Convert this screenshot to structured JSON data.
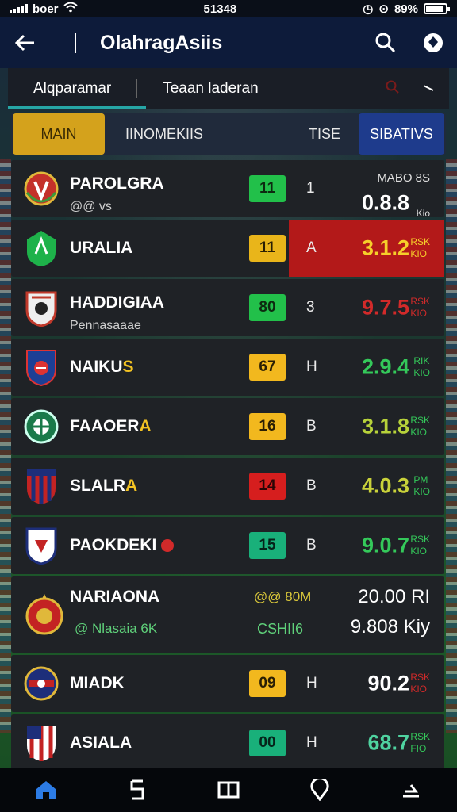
{
  "status": {
    "carrier": "boer",
    "time": "51348",
    "battery": "89%"
  },
  "appbar": {
    "title": "OlahragAsiis"
  },
  "tabs": {
    "active": "Alqparamar",
    "second": "Teaan laderan"
  },
  "filters": {
    "main": "MAIN",
    "second": "IINOMEKIIS",
    "rise": "TISE",
    "stats": "SIBATIVS"
  },
  "rows": [
    {
      "name": "PAROLGRA",
      "sub": "@@ vs",
      "badge": "11",
      "badge_color": "#22c04a",
      "letter": "1",
      "top_label": "MABO 8S",
      "odds": "0.8.8",
      "unit": "Kio",
      "odds_color": "#ffffff"
    },
    {
      "name": "URALIA",
      "badge": "11",
      "badge_color": "#e9b51a",
      "letter": "A",
      "odds": "3.1.2",
      "unit": "RSK\nKIO",
      "odds_color": "#f6cf2a",
      "unit_color": "#f6cf2a"
    },
    {
      "name": "HADDIGIAA",
      "sub": "Pennasaaae",
      "badge": "80",
      "badge_color": "#22c04a",
      "letter": "3",
      "odds": "9.7.5",
      "unit": "RSK\nKIO",
      "odds_color": "#d22a2a",
      "unit_color": "#d22a2a"
    },
    {
      "name": "NAIKU",
      "name_tail": "S",
      "badge": "67",
      "badge_color": "#f2b81e",
      "letter": "H",
      "odds": "2.9.4",
      "unit": "RIK\nKIO",
      "odds_color": "#34c95a",
      "unit_color": "#34c95a"
    },
    {
      "name": "FAAOER",
      "name_tail": "A",
      "badge": "16",
      "badge_color": "#f2b81e",
      "letter": "B",
      "odds": "3.1.8",
      "unit": "RSK\nKIO",
      "odds_color": "#b7d23a",
      "unit_color": "#34c95a"
    },
    {
      "name": "SLALR",
      "name_tail": "A",
      "badge": "14",
      "badge_color": "#d61e1e",
      "letter": "B",
      "odds": "4.0.3",
      "unit": "PM\nKIO",
      "odds_color": "#c9d23a",
      "unit_color": "#34c95a"
    },
    {
      "name": "PAOKDEKI",
      "badge": "15",
      "badge_color": "#19b07a",
      "letter": "B",
      "odds": "9.0.7",
      "unit": "RSK\nKIO",
      "odds_color": "#34c95a",
      "unit_color": "#34c95a"
    },
    {
      "name": "NARIAONA",
      "sub": "@ Nlasaia 6K",
      "mid_top": "@@ 80M",
      "mid_bottom": "CSHII6",
      "right_top": "20.00 RI",
      "right_bottom": "9.808 Kiy"
    },
    {
      "name": "MIADK",
      "badge": "09",
      "badge_color": "#f2b81e",
      "letter": "H",
      "odds": "90.2",
      "unit": "RSK\nKIO",
      "odds_color": "#ffffff",
      "unit_color": "#d22a2a"
    },
    {
      "name": "ASIALA",
      "badge": "00",
      "badge_color": "#19b07a",
      "letter": "H",
      "odds": "68.7",
      "unit": "RSK\nFIO",
      "odds_color": "#4fd3a0",
      "unit_color": "#34c95a"
    }
  ],
  "nav": [
    "home-icon",
    "schedule-icon",
    "book-icon",
    "location-icon",
    "share-icon"
  ],
  "accent": "#d4a21c"
}
